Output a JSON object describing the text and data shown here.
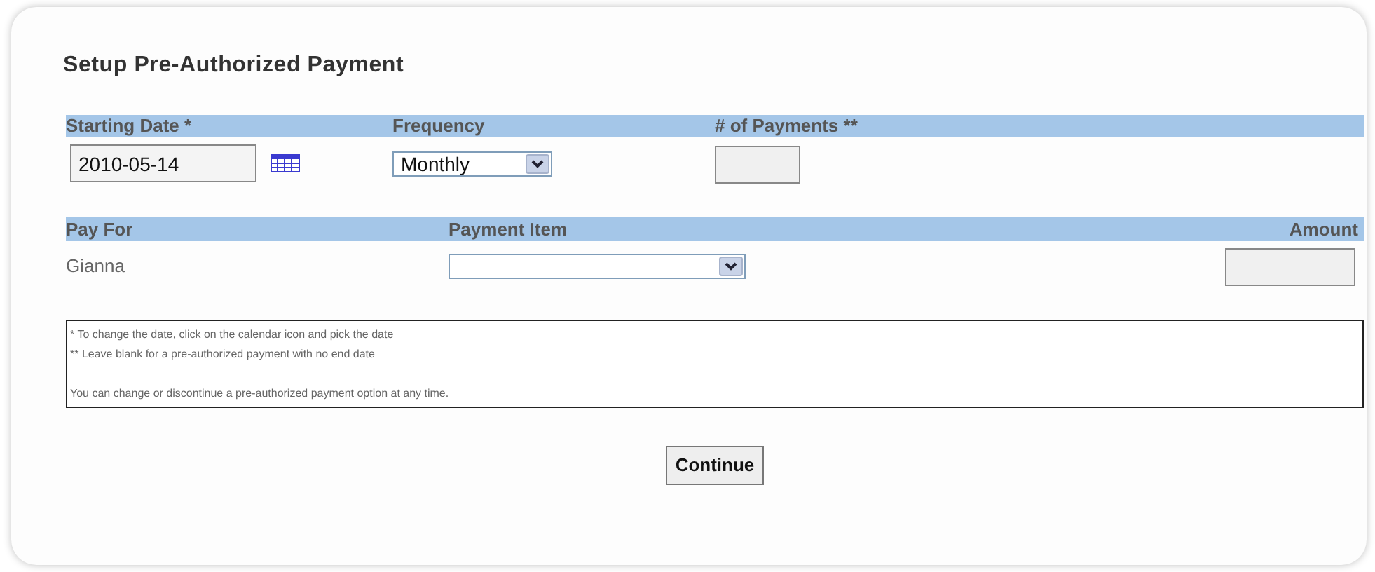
{
  "title": "Setup Pre-Authorized Payment",
  "schedule": {
    "columns": [
      "Starting Date *",
      "Frequency",
      "# of Payments **"
    ],
    "starting_date": {
      "value": "2010-05-14"
    },
    "frequency": {
      "value": "Monthly"
    }
  },
  "items": {
    "columns": [
      "Pay For",
      "Payment Item",
      "Amount"
    ],
    "rows": [
      {
        "pay_for": "Gianna"
      }
    ]
  },
  "notes": [
    "* To change the date, click on the calendar icon and pick the date",
    "** Leave blank for a pre-authorized payment with no end date",
    "You can change or discontinue a pre-authorized payment option at any time."
  ],
  "buttons": [
    "Continue"
  ]
}
